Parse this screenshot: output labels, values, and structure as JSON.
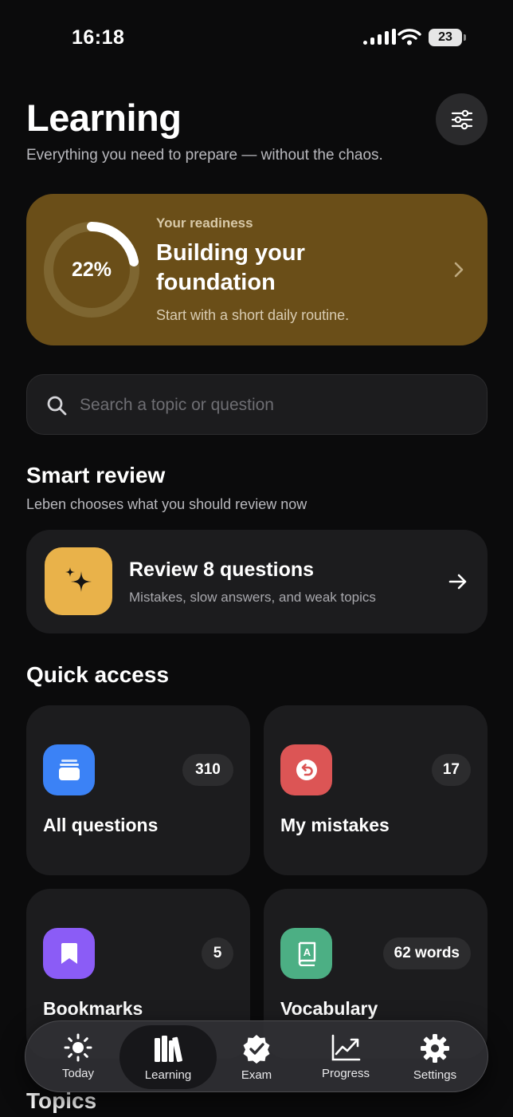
{
  "status_bar": {
    "time": "16:18",
    "battery": "23"
  },
  "header": {
    "title": "Learning",
    "subtitle": "Everything you need to prepare — without the chaos."
  },
  "readiness": {
    "eyebrow": "Your readiness",
    "percent_label": "22%",
    "progress_fraction": 0.22,
    "title": "Building your foundation",
    "subtitle": "Start with a short daily routine."
  },
  "search": {
    "placeholder": "Search a topic or question",
    "value": ""
  },
  "smart_review": {
    "title": "Smart review",
    "subtitle": "Leben chooses what you should review now",
    "card_title": "Review 8 questions",
    "card_subtitle": "Mistakes, slow answers, and weak topics"
  },
  "quick_access": {
    "title": "Quick access",
    "tiles": [
      {
        "label": "All questions",
        "badge": "310",
        "icon": "stack-icon",
        "color": "#3b82f6"
      },
      {
        "label": "My mistakes",
        "badge": "17",
        "icon": "undo-circle-icon",
        "color": "#dc5555"
      },
      {
        "label": "Bookmarks",
        "badge": "5",
        "icon": "bookmark-icon",
        "color": "#8b5cf6"
      },
      {
        "label": "Vocabulary",
        "badge": "62 words",
        "icon": "dictionary-icon",
        "color": "#4caf84"
      }
    ]
  },
  "topics": {
    "title": "Topics"
  },
  "tabbar": {
    "items": [
      {
        "label": "Today",
        "icon": "sun-icon"
      },
      {
        "label": "Learning",
        "icon": "books-icon",
        "active": true
      },
      {
        "label": "Exam",
        "icon": "check-badge-icon"
      },
      {
        "label": "Progress",
        "icon": "chart-icon"
      },
      {
        "label": "Settings",
        "icon": "gear-icon"
      }
    ]
  },
  "colors": {
    "background": "#0b0b0c",
    "card": "#1c1c1e",
    "readiness_card": "#6a4e18",
    "review_icon": "#e9b24a"
  }
}
